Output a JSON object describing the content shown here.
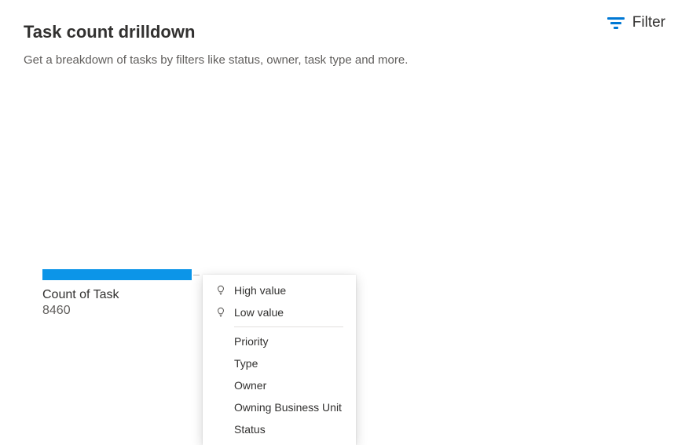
{
  "header": {
    "title": "Task count drilldown",
    "subtitle": "Get a breakdown of tasks by filters like status, owner, task type and more.",
    "filter_label": "Filter"
  },
  "chart_data": {
    "type": "bar",
    "title": "",
    "series": [
      {
        "name": "Count of Task",
        "value": 8460
      }
    ],
    "label": "Count of Task",
    "value": "8460"
  },
  "dropdown": {
    "high_value": "High value",
    "low_value": "Low value",
    "items": [
      "Priority",
      "Type",
      "Owner",
      "Owning Business Unit",
      "Status"
    ]
  }
}
